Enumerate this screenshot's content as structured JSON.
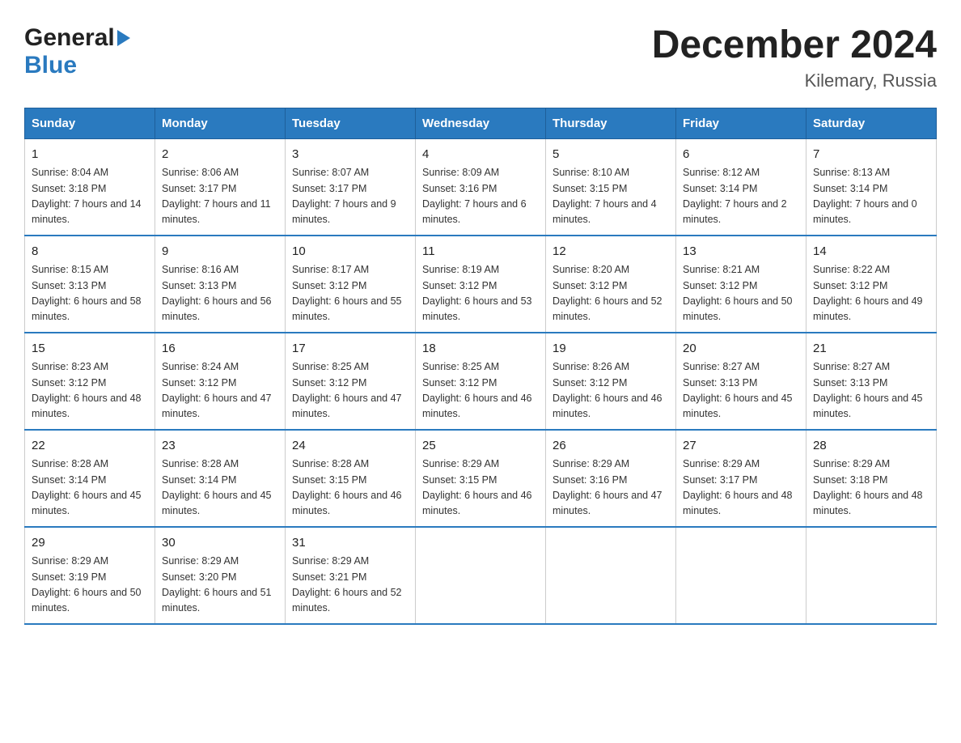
{
  "header": {
    "title": "December 2024",
    "subtitle": "Kilemary, Russia"
  },
  "logo": {
    "line1": "General",
    "line2": "Blue"
  },
  "days_of_week": [
    "Sunday",
    "Monday",
    "Tuesday",
    "Wednesday",
    "Thursday",
    "Friday",
    "Saturday"
  ],
  "weeks": [
    [
      {
        "date": "1",
        "sunrise": "Sunrise: 8:04 AM",
        "sunset": "Sunset: 3:18 PM",
        "daylight": "Daylight: 7 hours and 14 minutes."
      },
      {
        "date": "2",
        "sunrise": "Sunrise: 8:06 AM",
        "sunset": "Sunset: 3:17 PM",
        "daylight": "Daylight: 7 hours and 11 minutes."
      },
      {
        "date": "3",
        "sunrise": "Sunrise: 8:07 AM",
        "sunset": "Sunset: 3:17 PM",
        "daylight": "Daylight: 7 hours and 9 minutes."
      },
      {
        "date": "4",
        "sunrise": "Sunrise: 8:09 AM",
        "sunset": "Sunset: 3:16 PM",
        "daylight": "Daylight: 7 hours and 6 minutes."
      },
      {
        "date": "5",
        "sunrise": "Sunrise: 8:10 AM",
        "sunset": "Sunset: 3:15 PM",
        "daylight": "Daylight: 7 hours and 4 minutes."
      },
      {
        "date": "6",
        "sunrise": "Sunrise: 8:12 AM",
        "sunset": "Sunset: 3:14 PM",
        "daylight": "Daylight: 7 hours and 2 minutes."
      },
      {
        "date": "7",
        "sunrise": "Sunrise: 8:13 AM",
        "sunset": "Sunset: 3:14 PM",
        "daylight": "Daylight: 7 hours and 0 minutes."
      }
    ],
    [
      {
        "date": "8",
        "sunrise": "Sunrise: 8:15 AM",
        "sunset": "Sunset: 3:13 PM",
        "daylight": "Daylight: 6 hours and 58 minutes."
      },
      {
        "date": "9",
        "sunrise": "Sunrise: 8:16 AM",
        "sunset": "Sunset: 3:13 PM",
        "daylight": "Daylight: 6 hours and 56 minutes."
      },
      {
        "date": "10",
        "sunrise": "Sunrise: 8:17 AM",
        "sunset": "Sunset: 3:12 PM",
        "daylight": "Daylight: 6 hours and 55 minutes."
      },
      {
        "date": "11",
        "sunrise": "Sunrise: 8:19 AM",
        "sunset": "Sunset: 3:12 PM",
        "daylight": "Daylight: 6 hours and 53 minutes."
      },
      {
        "date": "12",
        "sunrise": "Sunrise: 8:20 AM",
        "sunset": "Sunset: 3:12 PM",
        "daylight": "Daylight: 6 hours and 52 minutes."
      },
      {
        "date": "13",
        "sunrise": "Sunrise: 8:21 AM",
        "sunset": "Sunset: 3:12 PM",
        "daylight": "Daylight: 6 hours and 50 minutes."
      },
      {
        "date": "14",
        "sunrise": "Sunrise: 8:22 AM",
        "sunset": "Sunset: 3:12 PM",
        "daylight": "Daylight: 6 hours and 49 minutes."
      }
    ],
    [
      {
        "date": "15",
        "sunrise": "Sunrise: 8:23 AM",
        "sunset": "Sunset: 3:12 PM",
        "daylight": "Daylight: 6 hours and 48 minutes."
      },
      {
        "date": "16",
        "sunrise": "Sunrise: 8:24 AM",
        "sunset": "Sunset: 3:12 PM",
        "daylight": "Daylight: 6 hours and 47 minutes."
      },
      {
        "date": "17",
        "sunrise": "Sunrise: 8:25 AM",
        "sunset": "Sunset: 3:12 PM",
        "daylight": "Daylight: 6 hours and 47 minutes."
      },
      {
        "date": "18",
        "sunrise": "Sunrise: 8:25 AM",
        "sunset": "Sunset: 3:12 PM",
        "daylight": "Daylight: 6 hours and 46 minutes."
      },
      {
        "date": "19",
        "sunrise": "Sunrise: 8:26 AM",
        "sunset": "Sunset: 3:12 PM",
        "daylight": "Daylight: 6 hours and 46 minutes."
      },
      {
        "date": "20",
        "sunrise": "Sunrise: 8:27 AM",
        "sunset": "Sunset: 3:13 PM",
        "daylight": "Daylight: 6 hours and 45 minutes."
      },
      {
        "date": "21",
        "sunrise": "Sunrise: 8:27 AM",
        "sunset": "Sunset: 3:13 PM",
        "daylight": "Daylight: 6 hours and 45 minutes."
      }
    ],
    [
      {
        "date": "22",
        "sunrise": "Sunrise: 8:28 AM",
        "sunset": "Sunset: 3:14 PM",
        "daylight": "Daylight: 6 hours and 45 minutes."
      },
      {
        "date": "23",
        "sunrise": "Sunrise: 8:28 AM",
        "sunset": "Sunset: 3:14 PM",
        "daylight": "Daylight: 6 hours and 45 minutes."
      },
      {
        "date": "24",
        "sunrise": "Sunrise: 8:28 AM",
        "sunset": "Sunset: 3:15 PM",
        "daylight": "Daylight: 6 hours and 46 minutes."
      },
      {
        "date": "25",
        "sunrise": "Sunrise: 8:29 AM",
        "sunset": "Sunset: 3:15 PM",
        "daylight": "Daylight: 6 hours and 46 minutes."
      },
      {
        "date": "26",
        "sunrise": "Sunrise: 8:29 AM",
        "sunset": "Sunset: 3:16 PM",
        "daylight": "Daylight: 6 hours and 47 minutes."
      },
      {
        "date": "27",
        "sunrise": "Sunrise: 8:29 AM",
        "sunset": "Sunset: 3:17 PM",
        "daylight": "Daylight: 6 hours and 48 minutes."
      },
      {
        "date": "28",
        "sunrise": "Sunrise: 8:29 AM",
        "sunset": "Sunset: 3:18 PM",
        "daylight": "Daylight: 6 hours and 48 minutes."
      }
    ],
    [
      {
        "date": "29",
        "sunrise": "Sunrise: 8:29 AM",
        "sunset": "Sunset: 3:19 PM",
        "daylight": "Daylight: 6 hours and 50 minutes."
      },
      {
        "date": "30",
        "sunrise": "Sunrise: 8:29 AM",
        "sunset": "Sunset: 3:20 PM",
        "daylight": "Daylight: 6 hours and 51 minutes."
      },
      {
        "date": "31",
        "sunrise": "Sunrise: 8:29 AM",
        "sunset": "Sunset: 3:21 PM",
        "daylight": "Daylight: 6 hours and 52 minutes."
      },
      {
        "date": "",
        "sunrise": "",
        "sunset": "",
        "daylight": ""
      },
      {
        "date": "",
        "sunrise": "",
        "sunset": "",
        "daylight": ""
      },
      {
        "date": "",
        "sunrise": "",
        "sunset": "",
        "daylight": ""
      },
      {
        "date": "",
        "sunrise": "",
        "sunset": "",
        "daylight": ""
      }
    ]
  ]
}
